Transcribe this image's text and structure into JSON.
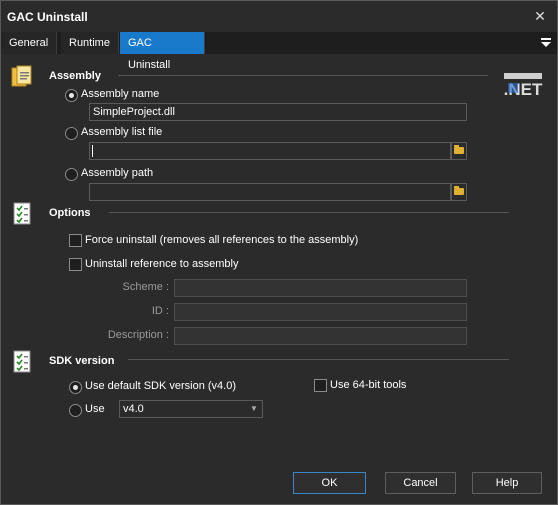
{
  "window": {
    "title": "GAC Uninstall"
  },
  "tabs": [
    {
      "label": "General"
    },
    {
      "label": "Runtime"
    },
    {
      "label": "GAC Uninstall"
    }
  ],
  "assembly": {
    "section_title": "Assembly",
    "name_option_label": "Assembly name",
    "name_value": "SimpleProject.dll",
    "list_file_option_label": "Assembly list file",
    "list_file_value": "",
    "path_option_label": "Assembly path",
    "path_value": ""
  },
  "options": {
    "section_title": "Options",
    "force_uninstall_label": "Force uninstall (removes all references to the assembly)",
    "uninstall_reference_label": "Uninstall reference to assembly",
    "scheme_label": "Scheme :",
    "id_label": "ID :",
    "description_label": "Description :"
  },
  "sdk": {
    "section_title": "SDK version",
    "use_default_label": "Use default SDK version (v4.0)",
    "use_label": "Use",
    "version_value": "v4.0",
    "use_64bit_label": "Use 64-bit tools"
  },
  "buttons": {
    "ok": "OK",
    "cancel": "Cancel",
    "help": "Help"
  },
  "colors": {
    "accent": "#1979ca",
    "background": "#2b2b2b",
    "folder": "#e0b030"
  },
  "icons": [
    "close-icon",
    "tab-menu-icon",
    "assembly-section-icon",
    "options-section-icon",
    "sdk-section-icon",
    "folder-icon",
    "logo-badge-icon",
    "chevron-down-icon"
  ]
}
